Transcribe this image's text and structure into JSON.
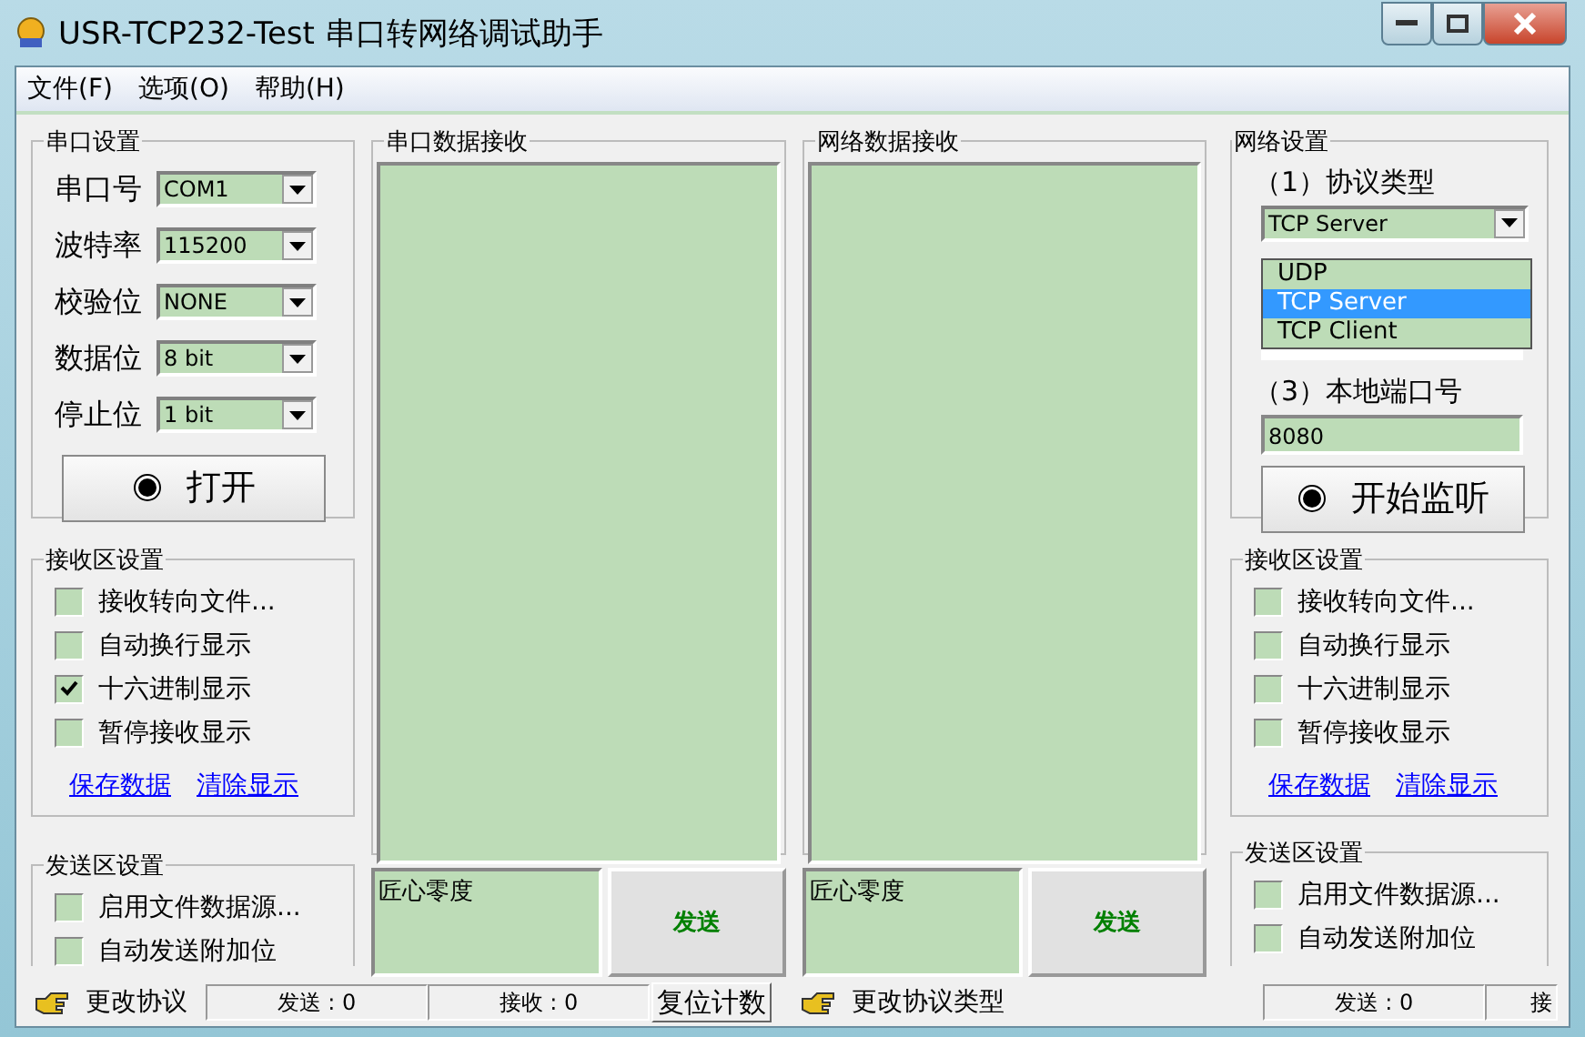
{
  "window": {
    "title": "USR-TCP232-Test 串口转网络调试助手"
  },
  "menu": [
    "文件(F)",
    "选项(O)",
    "帮助(H)"
  ],
  "serial_settings": {
    "title": "串口设置",
    "fields": [
      {
        "label": "串口号",
        "value": "COM1"
      },
      {
        "label": "波特率",
        "value": "115200"
      },
      {
        "label": "校验位",
        "value": "NONE"
      },
      {
        "label": "数据位",
        "value": "8 bit"
      },
      {
        "label": "停止位",
        "value": "1 bit"
      }
    ],
    "open_button": "打开"
  },
  "left_receive_settings": {
    "title": "接收区设置",
    "options": [
      {
        "label": "接收转向文件...",
        "checked": false
      },
      {
        "label": "自动换行显示",
        "checked": false
      },
      {
        "label": "十六进制显示",
        "checked": true
      },
      {
        "label": "暂停接收显示",
        "checked": false
      }
    ],
    "links": [
      "保存数据",
      "清除显示"
    ]
  },
  "left_send_settings": {
    "title": "发送区设置",
    "options": [
      {
        "label": "启用文件数据源...",
        "checked": false
      },
      {
        "label": "自动发送附加位",
        "checked": false
      }
    ]
  },
  "serial_receive": {
    "title": "串口数据接收"
  },
  "serial_send": {
    "value": "匠心零度",
    "button": "发送"
  },
  "network_receive": {
    "title": "网络数据接收"
  },
  "network_send": {
    "value": "匠心零度",
    "button": "发送"
  },
  "network_settings": {
    "title": "网络设置",
    "protocol_label": "（1）协议类型",
    "protocol_value": "TCP Server",
    "protocol_options": [
      {
        "label": "UDP",
        "selected": false
      },
      {
        "label": "TCP Server",
        "selected": true
      },
      {
        "label": "TCP Client",
        "selected": false
      }
    ],
    "port_label": "（3）本地端口号",
    "port_value": "8080",
    "listen_button": "开始监听"
  },
  "right_receive_settings": {
    "title": "接收区设置",
    "options": [
      {
        "label": "接收转向文件...",
        "checked": false
      },
      {
        "label": "自动换行显示",
        "checked": false
      },
      {
        "label": "十六进制显示",
        "checked": false
      },
      {
        "label": "暂停接收显示",
        "checked": false
      }
    ],
    "links": [
      "保存数据",
      "清除显示"
    ]
  },
  "right_send_settings": {
    "title": "发送区设置",
    "options": [
      {
        "label": "启用文件数据源...",
        "checked": false
      },
      {
        "label": "自动发送附加位",
        "checked": false
      }
    ]
  },
  "left_status": {
    "hint": "更改协议",
    "sent": "发送 : 0",
    "received": "接收 : 0",
    "reset_button": "复位计数"
  },
  "right_status": {
    "hint": "更改协议类型",
    "sent": "发送 : 0",
    "received": "接"
  }
}
